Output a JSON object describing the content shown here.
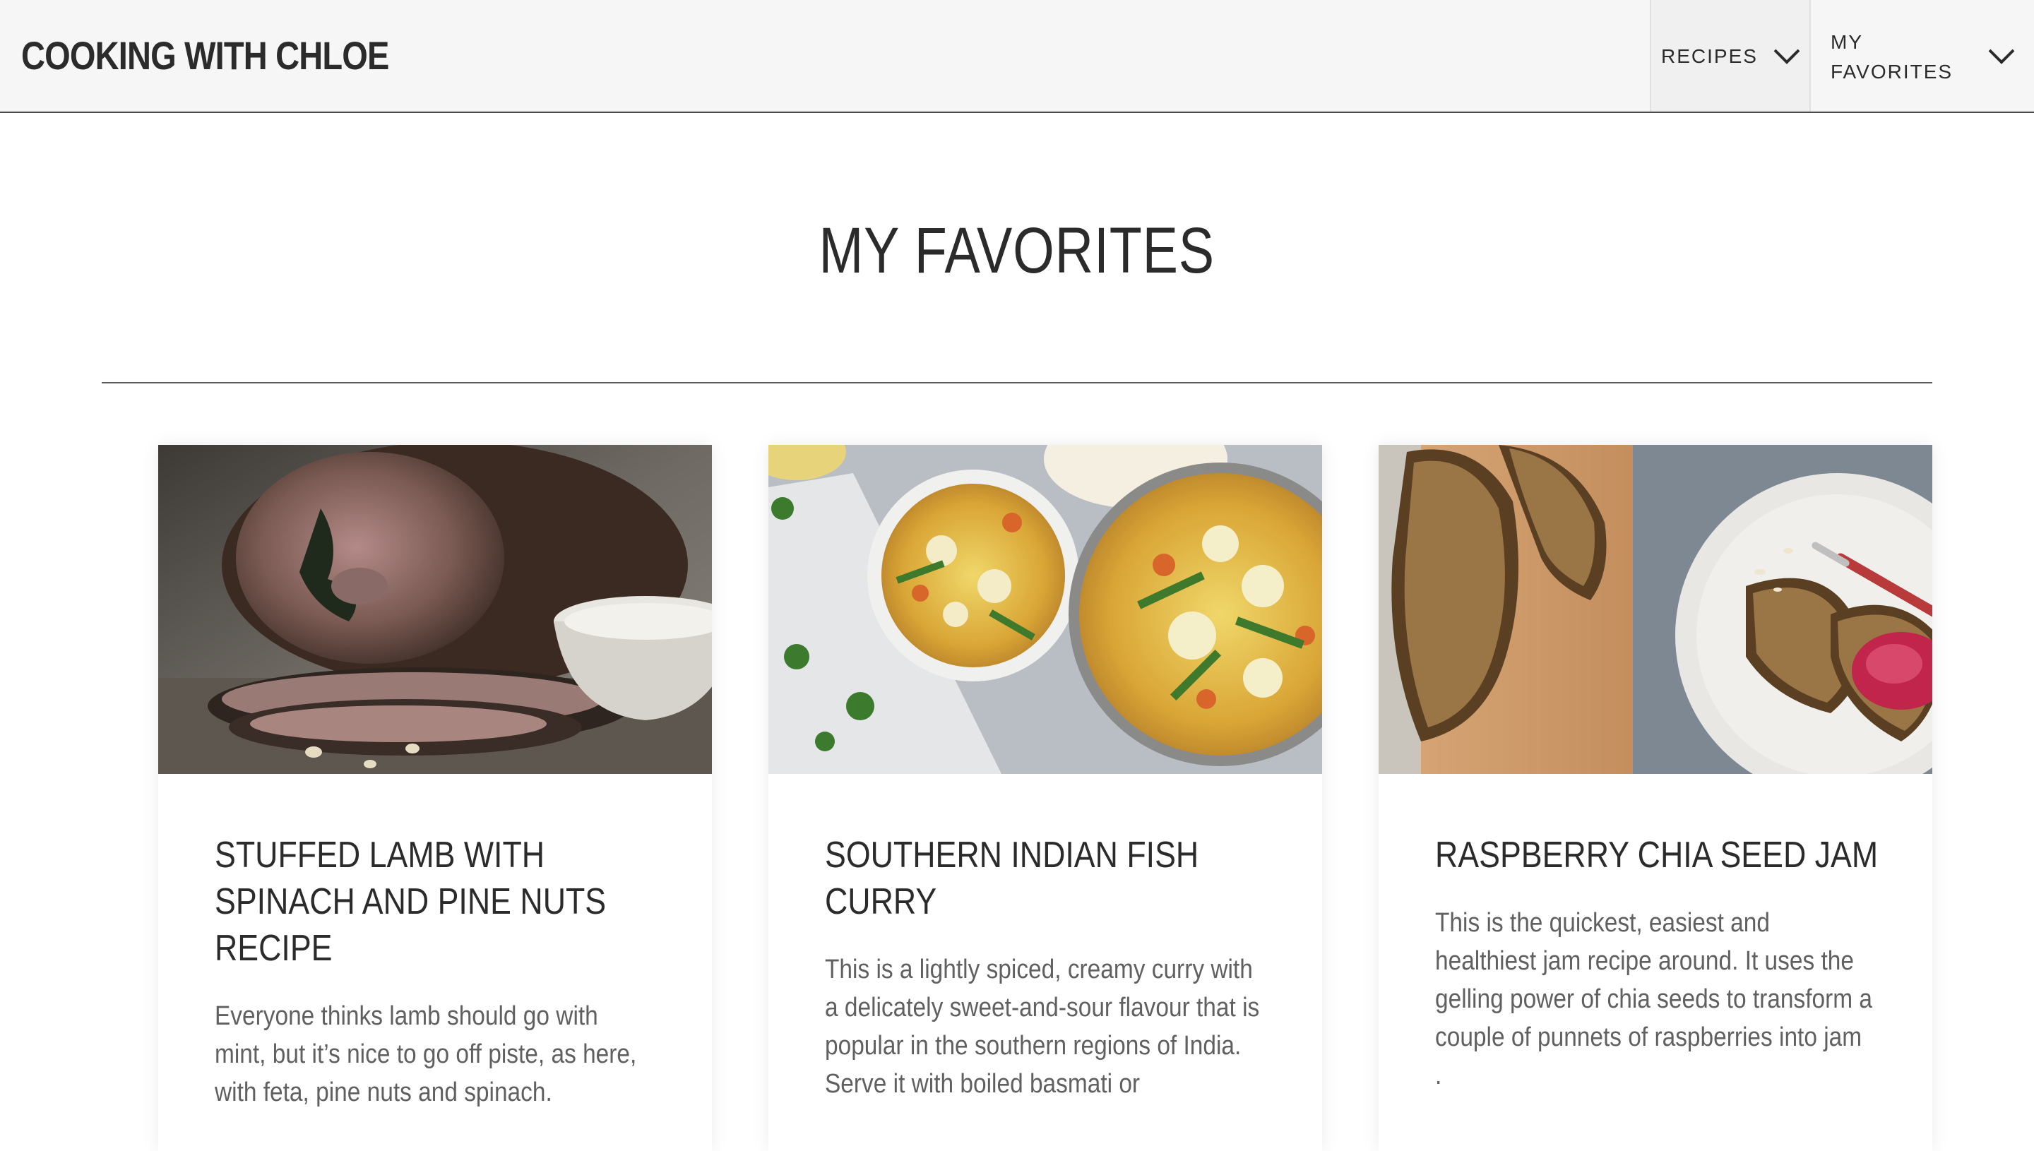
{
  "header": {
    "brand": "COOKING WITH CHLOE",
    "nav": [
      {
        "label": "RECIPES",
        "icon": "chevron-down-icon"
      },
      {
        "label": "MY FAVORITES",
        "icon": "chevron-down-icon"
      }
    ]
  },
  "main": {
    "title": "MY FAVORITES",
    "cards": [
      {
        "title": "STUFFED LAMB WITH SPINACH AND PINE NUTS RECIPE",
        "description": "Everyone thinks lamb should go with mint, but it’s nice to go off piste, as here, with feta, pine nuts and spinach.",
        "image": "stuffed-lamb-photo"
      },
      {
        "title": "SOUTHERN INDIAN FISH CURRY",
        "description": "This is a lightly spiced, creamy curry with a delicately sweet-and-sour flavour that is popular in the southern regions of India. Serve it with boiled basmati or",
        "image": "fish-curry-photo"
      },
      {
        "title": "RASPBERRY CHIA SEED JAM",
        "description": "This is the quickest, easiest and healthiest jam recipe around. It uses the gelling power of chia seeds to transform a couple of punnets of raspberries into jam .",
        "image": "raspberry-jam-photo"
      }
    ]
  },
  "colors": {
    "header_bg": "#f6f6f6",
    "text_dark": "#2b2b2b",
    "text_muted": "#606060",
    "divider": "#5a5a5a"
  }
}
